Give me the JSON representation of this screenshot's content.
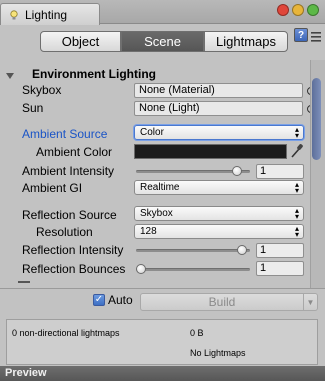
{
  "window": {
    "tab_title": "Lighting",
    "tab_icon": "lightbulb-icon",
    "traffic_colors": [
      "#e0463a",
      "#e8b53a",
      "#5cb847"
    ]
  },
  "tabs": [
    {
      "label": "Object",
      "active": false
    },
    {
      "label": "Scene",
      "active": true
    },
    {
      "label": "Lightmaps",
      "active": false
    }
  ],
  "environment": {
    "section_title": "Environment Lighting",
    "skybox_label": "Skybox",
    "skybox_value": "None (Material)",
    "sun_label": "Sun",
    "sun_value": "None (Light)",
    "ambient_source_label": "Ambient Source",
    "ambient_source_value": "Color",
    "ambient_color_label": "Ambient Color",
    "ambient_color": "#1b1b1b",
    "ambient_intensity_label": "Ambient Intensity",
    "ambient_intensity_value": "1",
    "ambient_intensity_fraction": 0.92,
    "ambient_gi_label": "Ambient GI",
    "ambient_gi_value": "Realtime"
  },
  "reflection": {
    "source_label": "Reflection Source",
    "source_value": "Skybox",
    "resolution_label": "Resolution",
    "resolution_value": "128",
    "intensity_label": "Reflection Intensity",
    "intensity_value": "1",
    "intensity_fraction": 0.97,
    "bounces_label": "Reflection Bounces",
    "bounces_value": "1",
    "bounces_fraction": 0.0
  },
  "build": {
    "auto_label": "Auto",
    "auto_checked": true,
    "build_label": "Build"
  },
  "stats": {
    "lightmaps_label": "0 non-directional lightmaps",
    "size_value": "0 B",
    "no_lightmaps": "No Lightmaps"
  },
  "preview": {
    "label": "Preview"
  }
}
